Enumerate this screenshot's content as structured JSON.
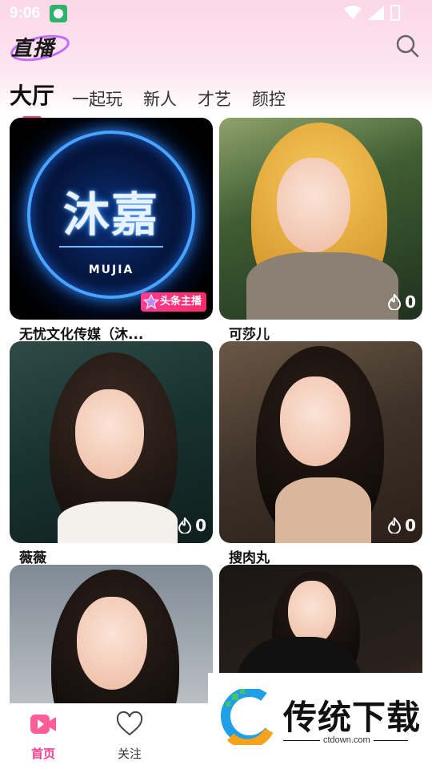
{
  "status_bar": {
    "time": "9:06"
  },
  "header": {
    "logo_text": "直播"
  },
  "tabs": [
    {
      "label": "大厅",
      "active": true
    },
    {
      "label": "一起玩",
      "active": false
    },
    {
      "label": "新人",
      "active": false
    },
    {
      "label": "才艺",
      "active": false
    },
    {
      "label": "颜控",
      "active": false
    }
  ],
  "cards": [
    {
      "name": "无忧文化传媒（沐...",
      "thumb_title": "沐嘉",
      "thumb_sub": "MUJIA",
      "badge": "头条主播"
    },
    {
      "name": "可莎儿",
      "heat": "0"
    },
    {
      "name": "薇薇",
      "heat": "0"
    },
    {
      "name": "搜肉丸",
      "heat": "0"
    },
    {
      "name": ""
    },
    {
      "name": ""
    }
  ],
  "bottom_nav": [
    {
      "label": "首页",
      "icon": "live-video-icon",
      "active": true
    },
    {
      "label": "关注",
      "icon": "heart-icon",
      "active": false
    }
  ],
  "watermark": {
    "text": "传统下载",
    "url": "ctdown.com"
  },
  "colors": {
    "accent": "#ff3d8e"
  }
}
